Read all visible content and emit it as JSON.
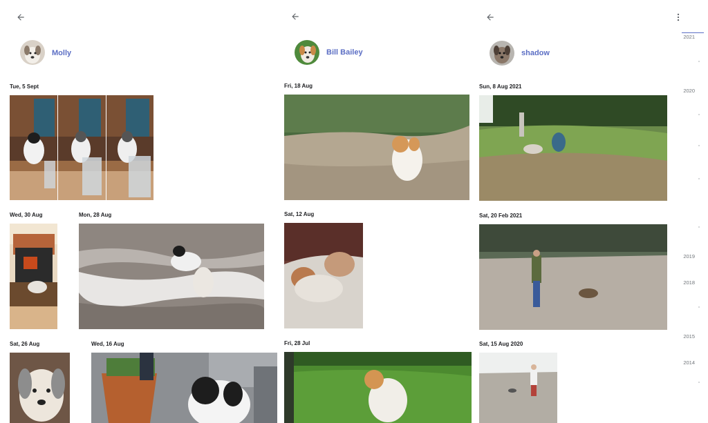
{
  "colors": {
    "accent": "#5b6ec4",
    "date_text": "#202124",
    "scale_text": "#70757a"
  },
  "columns": [
    {
      "back_icon": "arrow-left-icon",
      "person": {
        "name": "Molly",
        "avatar_icon": "dog-avatar"
      },
      "groups": [
        {
          "date": "Tue, 5 Sept",
          "photos": 3
        },
        {
          "date": "Wed, 30 Aug",
          "photos": 1
        },
        {
          "date": "Mon, 28 Aug",
          "photos": 1
        },
        {
          "date": "Sat, 26 Aug",
          "photos": 1
        },
        {
          "date": "Wed, 16 Aug",
          "photos": 1
        }
      ]
    },
    {
      "back_icon": "arrow-left-icon",
      "person": {
        "name": "Bill Bailey",
        "avatar_icon": "dog-avatar"
      },
      "groups": [
        {
          "date": "Fri, 18 Aug",
          "photos": 1
        },
        {
          "date": "Sat, 12 Aug",
          "photos": 1
        },
        {
          "date": "Fri, 28 Jul",
          "photos": 1
        }
      ]
    },
    {
      "back_icon": "arrow-left-icon",
      "more_icon": "more-vert-icon",
      "person": {
        "name": "shadow",
        "avatar_icon": "dog-avatar"
      },
      "groups": [
        {
          "date": "Sun, 8 Aug 2021",
          "photos": 1
        },
        {
          "date": "Sat, 20 Feb 2021",
          "photos": 1
        },
        {
          "date": "Sat, 15 Aug 2020",
          "photos": 1
        }
      ]
    }
  ],
  "year_scale": [
    "2021",
    "2020",
    "2019",
    "2018",
    "2015",
    "2014"
  ]
}
